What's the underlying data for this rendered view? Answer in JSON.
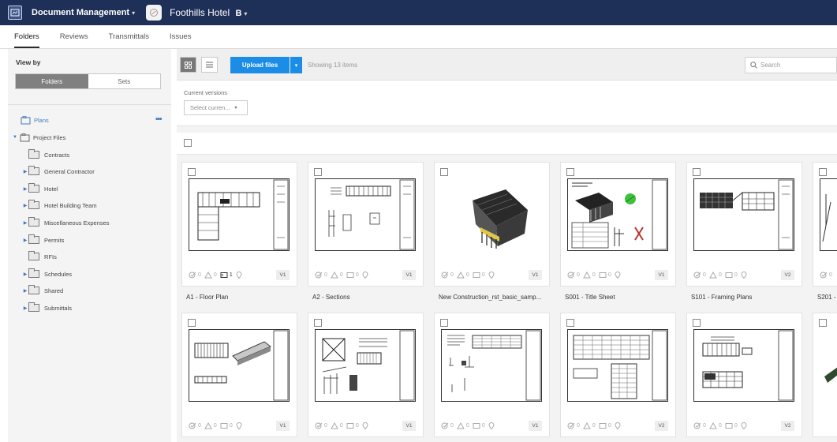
{
  "header": {
    "app_name": "Document Management",
    "app_caret": "▾",
    "project_name": "Foothills Hotel",
    "project_badge": "B",
    "project_caret": "▾"
  },
  "tabs": [
    {
      "label": "Folders",
      "active": true
    },
    {
      "label": "Reviews"
    },
    {
      "label": "Transmittals"
    },
    {
      "label": "Issues"
    }
  ],
  "sidebar": {
    "view_by_label": "View by",
    "view_by_options": [
      "Folders",
      "Sets"
    ],
    "view_by_selected": "Folders",
    "plans_label": "Plans",
    "plans_menu": "•••",
    "project_files_label": "Project Files",
    "folders": [
      {
        "label": "Contracts",
        "expandable": false
      },
      {
        "label": "General Contractor",
        "expandable": true
      },
      {
        "label": "Hotel",
        "expandable": true
      },
      {
        "label": "Hotel Building Team",
        "expandable": true
      },
      {
        "label": "Miscellaneous Expenses",
        "expandable": true
      },
      {
        "label": "Permits",
        "expandable": true
      },
      {
        "label": "RFIs",
        "expandable": false
      },
      {
        "label": "Schedules",
        "expandable": true
      },
      {
        "label": "Shared",
        "expandable": true
      },
      {
        "label": "Submittals",
        "expandable": true
      }
    ]
  },
  "toolbar": {
    "upload_label": "Upload files",
    "upload_dropdown": "▾",
    "showing_text": "Showing 13 items",
    "search_placeholder": "Search"
  },
  "filter": {
    "label": "Current versions",
    "select_value": "Select curren...",
    "select_caret": "▾"
  },
  "cards": [
    {
      "name": "A1 - Floor Plan",
      "version": "V1",
      "stats": [
        "0",
        "0",
        "1"
      ]
    },
    {
      "name": "A2 - Sections",
      "version": "V1",
      "stats": [
        "0",
        "0",
        "0"
      ]
    },
    {
      "name": "New Construction_rst_basic_samp...",
      "version": "V1",
      "stats": [
        "0",
        "0",
        "0"
      ]
    },
    {
      "name": "S001 - Title Sheet",
      "version": "V1",
      "stats": [
        "0",
        "0",
        "0"
      ]
    },
    {
      "name": "S101 - Framing Plans",
      "version": "V2",
      "stats": [
        "0",
        "0",
        "0"
      ]
    },
    {
      "name": "S201 -",
      "version": "",
      "stats": [
        "0",
        "",
        ""
      ]
    },
    {
      "name": "",
      "version": "V1",
      "stats": [
        "0",
        "0",
        "0"
      ]
    },
    {
      "name": "",
      "version": "V1",
      "stats": [
        "0",
        "0",
        "0"
      ]
    },
    {
      "name": "",
      "version": "V1",
      "stats": [
        "0",
        "0",
        "0"
      ]
    },
    {
      "name": "",
      "version": "V2",
      "stats": [
        "0",
        "0",
        "0"
      ]
    },
    {
      "name": "",
      "version": "V2",
      "stats": [
        "0",
        "0",
        "0"
      ]
    },
    {
      "name": "",
      "version": "",
      "stats": [
        "",
        "",
        ""
      ]
    }
  ],
  "colors": {
    "header_bg": "#1f3058",
    "primary_blue": "#1b8de6",
    "link_blue": "#3f7ac1"
  }
}
